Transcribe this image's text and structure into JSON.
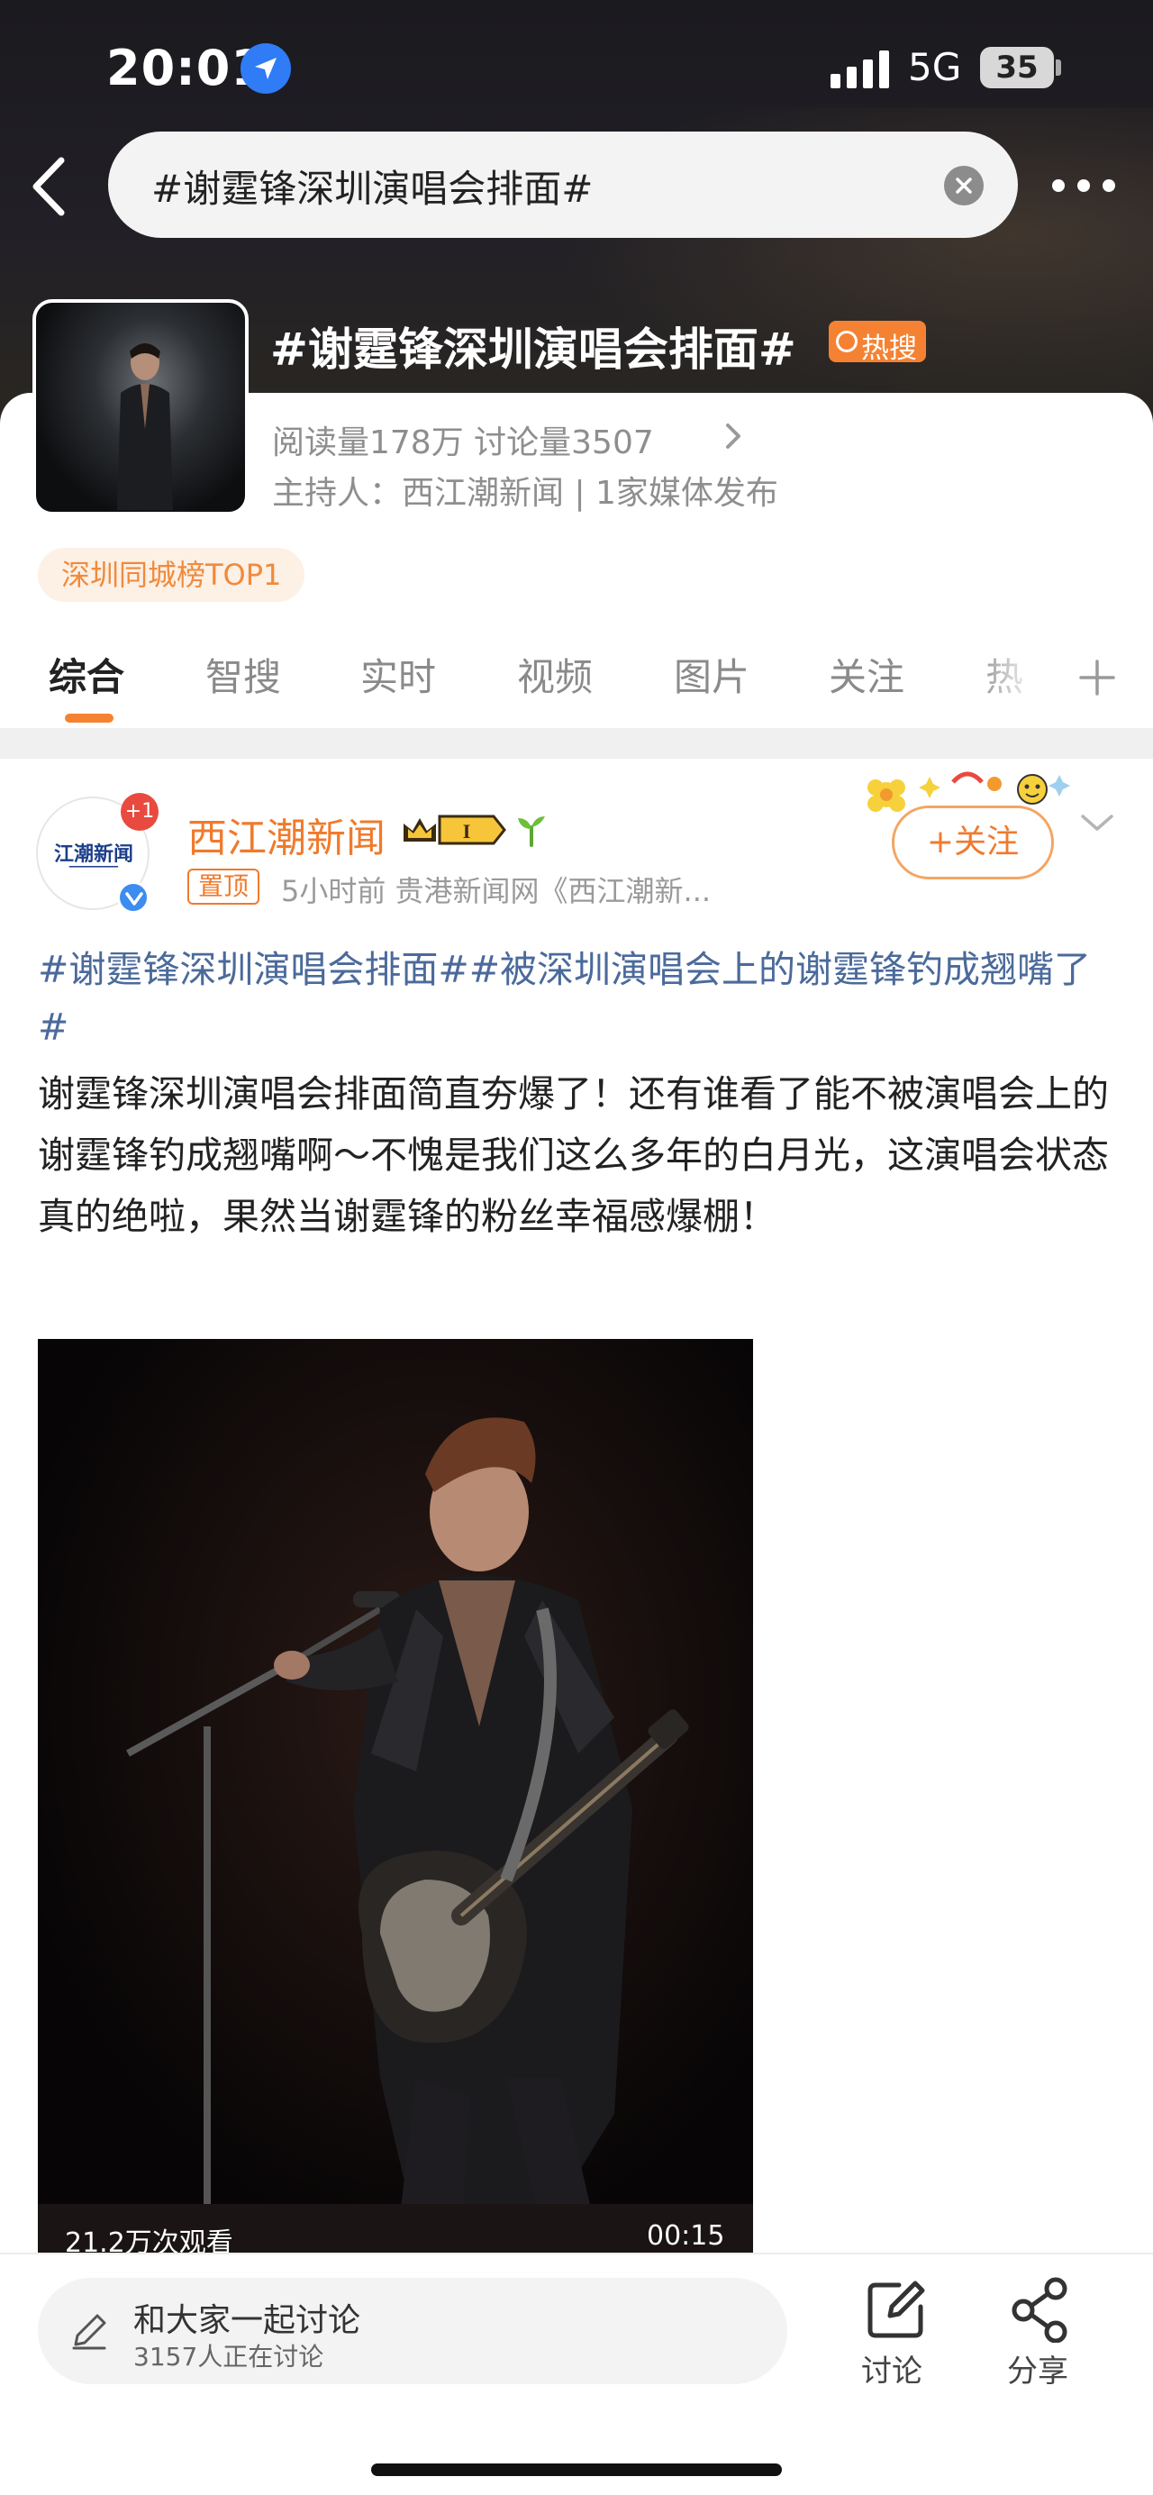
{
  "status_bar": {
    "time": "20:01",
    "network": "5G",
    "battery": "35"
  },
  "search": {
    "query": "#谢霆锋深圳演唱会排面#"
  },
  "topic": {
    "title": "#谢霆锋深圳演唱会排面#",
    "hot_badge": "热搜",
    "stats": "阅读量178万  讨论量3507",
    "host": "主持人：西江潮新闻 | 1家媒体发布",
    "rank_badge": "深圳同城榜TOP1"
  },
  "tabs": [
    "综合",
    "智搜",
    "实时",
    "视频",
    "图片",
    "关注",
    "热"
  ],
  "post": {
    "avatar_text": "江潮新闻",
    "notification": "+1",
    "author": "西江潮新闻",
    "pinned_label": "置顶",
    "meta": "5小时前  贵港新闻网《西江潮新...",
    "follow_label": "+关注",
    "tags": "#谢霆锋深圳演唱会排面##被深圳演唱会上的谢霆锋钓成翘嘴了#",
    "body": "谢霆锋深圳演唱会排面简直夯爆了！还有谁看了能不被演唱会上的谢霆锋钓成翘嘴啊～不愧是我们这么多年的白月光，这演唱会状态真的绝啦，果然当谢霆锋的粉丝幸福感爆棚！",
    "video": {
      "views": "21.2万次观看",
      "duration": "00:15"
    }
  },
  "bottom_bar": {
    "comment_title": "和大家一起讨论",
    "comment_sub": "3157人正在讨论",
    "discuss_label": "讨论",
    "share_label": "分享"
  },
  "icons": {
    "location": "location-arrow-icon",
    "back": "chevron-left-icon",
    "clear": "clear-icon",
    "more": "more-dots-icon",
    "crown": "crown-level-icon",
    "sprout": "sprout-icon",
    "expand": "chevron-down-icon",
    "plus": "plus-icon",
    "pencil": "pencil-icon",
    "discuss": "edit-square-icon",
    "share": "share-icon"
  },
  "colors": {
    "accent": "#f58232",
    "author": "#f07a2c",
    "tag_link": "#4b6a9b",
    "verified": "#3d8df0"
  }
}
